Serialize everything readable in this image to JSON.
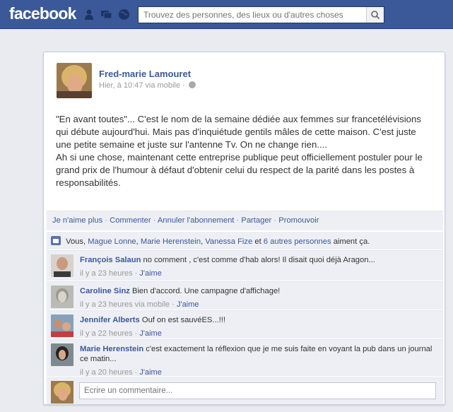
{
  "topbar": {
    "logo": "facebook",
    "search_placeholder": "Trouvez des personnes, des lieux ou d'autres choses",
    "icons": [
      "friend-requests-icon",
      "messages-icon",
      "notifications-globe-icon",
      "search-icon"
    ],
    "bg_color": "#3b5998"
  },
  "post": {
    "author": "Fred-marie Lamouret",
    "meta": "Hier, à 10:47 via mobile ·",
    "text": "\"En avant toutes\"... C'est le nom de la semaine dédiée aux femmes sur francetélévisions qui débute aujourd'hui. Mais pas d'inquiétude gentils mâles de cette maison. C'est juste une petite semaine et juste sur l'antenne Tv. On ne change rien....\nAh si une chose, maintenant cette entreprise publique peut officiellement postuler pour le grand prix de l'humour à défaut d'obtenir celui du respect de la parité dans les postes à responsabilités."
  },
  "actions": {
    "unlike": "Je n'aime plus",
    "comment": "Commenter",
    "unsubscribe": "Annuler l'abonnement",
    "share": "Partager",
    "promote": "Promouvoir",
    "sep": "·"
  },
  "likes": {
    "prefix": "Vous,",
    "p1": "Mague Lonne",
    "p2": "Marie Herenstein",
    "p3": "Vanessa Fize",
    "and": "et",
    "others": "6 autres personnes",
    "suffix": "aiment ça."
  },
  "comments": [
    {
      "name": "François Salaun",
      "text": "no comment , c'est comme d'hab alors! Il disait quoi déjà Aragon...",
      "time": "il y a 23 heures",
      "like": "J'aime"
    },
    {
      "name": "Caroline Sinz",
      "text": "Bien d'accord. Une campagne d'affichage!",
      "time": "il y a 23 heures via mobile",
      "like": "J'aime"
    },
    {
      "name": "Jennifer Alberts",
      "text": "Ouf on est sauvéES...!!!",
      "time": "il y a 22 heures",
      "like": "J'aime"
    },
    {
      "name": "Marie Herenstein",
      "text": "c'est exactement la réflexion que je me suis faite en voyant la pub dans un journal ce matin...",
      "time": "il y a 20 heures",
      "like": "J'aime"
    }
  ],
  "compose": {
    "placeholder": "Écrire un commentaire..."
  }
}
